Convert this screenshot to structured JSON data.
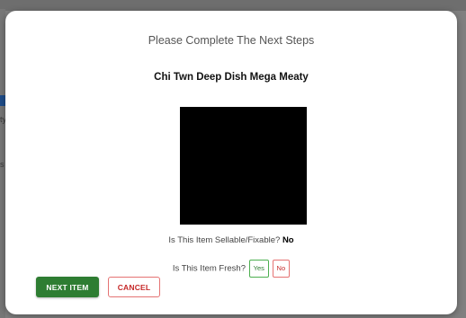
{
  "modal": {
    "title": "Please Complete The Next Steps",
    "item_name": "Chi Twn Deep Dish Mega Meaty"
  },
  "questions": {
    "sellable": {
      "label": "Is This Item Sellable/Fixable?",
      "answer": "No"
    },
    "fresh": {
      "label": "Is This Item Fresh?",
      "yes_label": "Yes",
      "no_label": "No"
    }
  },
  "actions": {
    "next_label": "NEXT ITEM",
    "cancel_label": "CANCEL"
  },
  "colors": {
    "primary_green": "#2e7d32",
    "danger_red": "#c62828",
    "image_placeholder": "#000000"
  },
  "background": {
    "glyph_a": "ty",
    "glyph_b": "s"
  }
}
